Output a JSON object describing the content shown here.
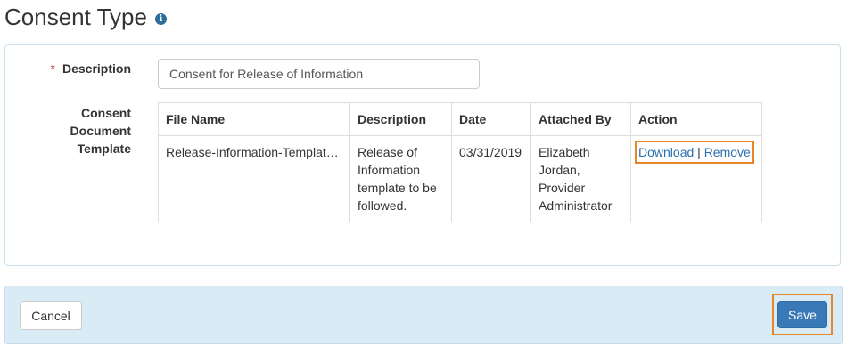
{
  "page": {
    "title": "Consent Type",
    "info_icon": "info-icon"
  },
  "form": {
    "description_label": "Description",
    "required_marker": "*",
    "description_value": "Consent for Release of Information",
    "template_label_lines": [
      "Consent",
      "Document",
      "Template"
    ]
  },
  "table": {
    "headers": [
      "File Name",
      "Description",
      "Date",
      "Attached By",
      "Action"
    ],
    "rows": [
      {
        "file_name": "Release-Information-Templat…",
        "description_lines": [
          "Release of",
          "Information",
          "template to be",
          "followed."
        ],
        "date": "03/31/2019",
        "attached_by_lines": [
          "Elizabeth",
          "Jordan,",
          "Provider",
          "Administrator"
        ],
        "action_download": "Download",
        "action_separator": "|",
        "action_remove": "Remove"
      }
    ]
  },
  "footer": {
    "cancel_label": "Cancel",
    "save_label": "Save"
  },
  "colors": {
    "highlight": "#e8862a",
    "link": "#2a6fb0",
    "primary_button": "#3a79b8",
    "footer_bg": "#d9ebf5"
  }
}
